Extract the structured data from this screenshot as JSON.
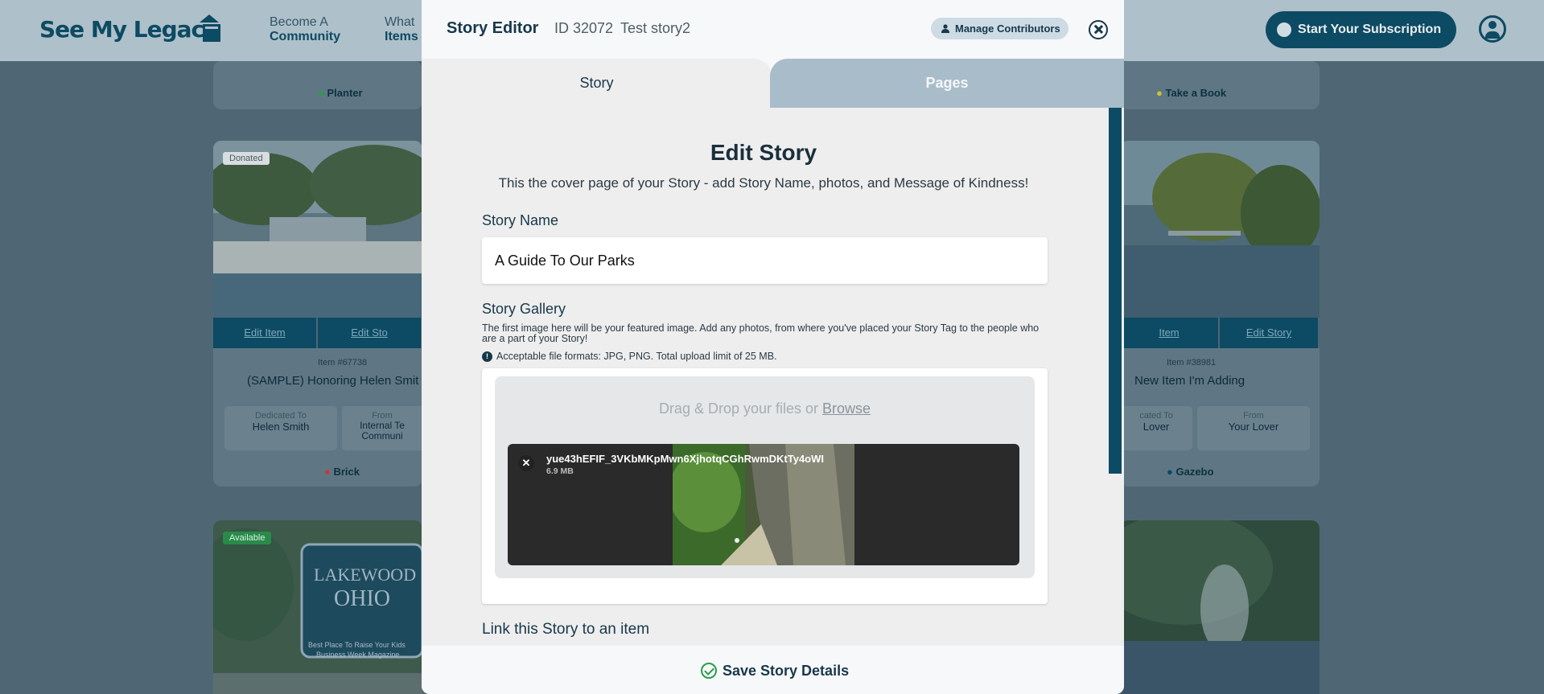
{
  "background": {
    "logo": "See My Legacy",
    "nav": [
      {
        "line1": "Become A",
        "line2": "Community"
      },
      {
        "line1": "What",
        "line2": "Items"
      }
    ],
    "subscribe_label": "Start Your Subscription",
    "cards": [
      {
        "location": "Planter"
      },
      {
        "location": "Take a Book"
      },
      {
        "badge": "Donated",
        "edit_item": "Edit Item",
        "edit_story": "Edit Sto",
        "item_no": "Item #67738",
        "title": "(SAMPLE) Honoring Helen Smit",
        "dedicated_label": "Dedicated To",
        "dedicated_value": "Helen Smith",
        "from_label": "From",
        "from_value": "Internal Te Communi",
        "location": "Brick"
      },
      {
        "edit_item": "Item",
        "edit_story": "Edit Story",
        "item_no": "Item #38981",
        "title": "New Item I'm Adding",
        "dedicated_label": "cated To",
        "dedicated_value": "Lover",
        "from_label": "From",
        "from_value": "Your Lover",
        "location": "Gazebo"
      },
      {
        "badge": "Available",
        "sign_line1": "LAKEWOOD",
        "sign_line2": "OHIO",
        "sign_line3": "Best Place To Raise Your Kids",
        "sign_line4": "Business Week Magazine"
      }
    ]
  },
  "modal": {
    "title": "Story Editor",
    "id": "ID 32072",
    "story_name_header": "Test story2",
    "manage_contributors": "Manage Contributors",
    "tabs": [
      "Story",
      "Pages"
    ],
    "heading": "Edit Story",
    "subheading": "This the cover page of your Story - add Story Name, photos, and Message of Kindness!",
    "story_name_label": "Story Name",
    "story_name_value": "A Guide To Our Parks",
    "gallery_label": "Story Gallery",
    "gallery_help": "The first image here will be your featured image. Add any photos, from where you've placed your Story Tag to the people who are a part of your Story!",
    "formats_note": "Acceptable file formats: JPG, PNG. Total upload limit of 25 MB.",
    "dropzone_text": "Drag & Drop your files or ",
    "dropzone_browse": "Browse",
    "file": {
      "name": "yue43hEFIF_3VKbMKpMwn6XjhotqCGhRwmDKtTy4oWI",
      "size": "6.9 MB"
    },
    "link_label": "Link this Story to an item",
    "save_label": "Save Story Details"
  },
  "colors": {
    "brand": "#0d4a63",
    "accent_green": "#2a9d4b",
    "tab_inactive": "#a9bcca"
  }
}
